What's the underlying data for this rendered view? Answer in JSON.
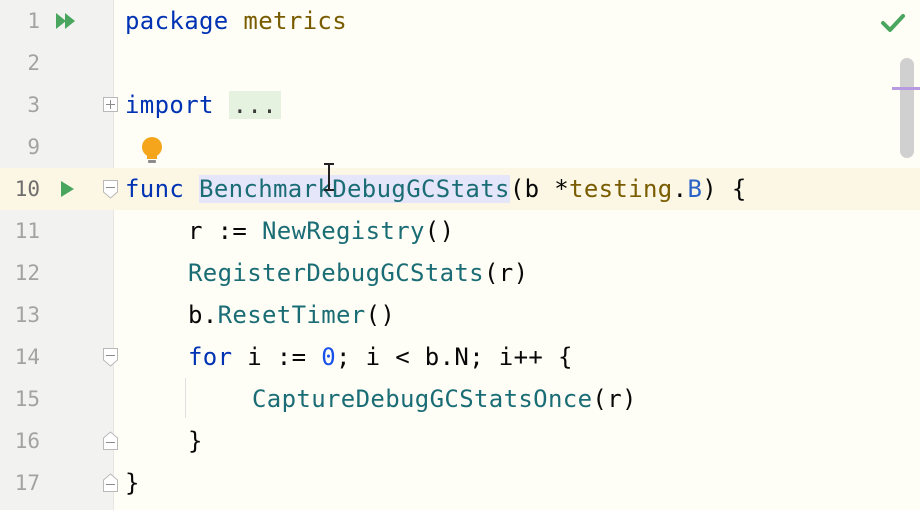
{
  "editor": {
    "status_icon": "check-icon",
    "intention_icon": "lightbulb-icon",
    "lines": [
      {
        "num": "1",
        "parts": [
          {
            "t": "package",
            "c": "kw"
          },
          {
            "t": " "
          },
          {
            "t": "metrics",
            "c": "pkg"
          }
        ]
      },
      {
        "num": "2",
        "parts": []
      },
      {
        "num": "3",
        "parts": [
          {
            "t": "import",
            "c": "kw"
          },
          {
            "t": " "
          },
          {
            "t": "...",
            "c": "fold"
          }
        ]
      },
      {
        "num": "9",
        "parts": []
      },
      {
        "num": "10",
        "parts": [
          {
            "t": "func",
            "c": "kw"
          },
          {
            "t": " "
          },
          {
            "t": "BenchmarkDebugGCStats",
            "c": "fndecl"
          },
          {
            "t": "(b *"
          },
          {
            "t": "testing",
            "c": "type"
          },
          {
            "t": "."
          },
          {
            "t": "B",
            "c": "tsel"
          },
          {
            "t": ") {"
          }
        ]
      },
      {
        "num": "11",
        "parts": [
          {
            "t": "r := "
          },
          {
            "t": "NewRegistry",
            "c": "fn"
          },
          {
            "t": "()"
          }
        ]
      },
      {
        "num": "12",
        "parts": [
          {
            "t": "RegisterDebugGCStats",
            "c": "fn"
          },
          {
            "t": "(r)"
          }
        ]
      },
      {
        "num": "13",
        "parts": [
          {
            "t": "b."
          },
          {
            "t": "ResetTimer",
            "c": "fn"
          },
          {
            "t": "()"
          }
        ]
      },
      {
        "num": "14",
        "parts": [
          {
            "t": "for",
            "c": "kw"
          },
          {
            "t": " i := "
          },
          {
            "t": "0",
            "c": "num"
          },
          {
            "t": "; i < b.N; i++ {"
          }
        ]
      },
      {
        "num": "15",
        "parts": [
          {
            "t": "CaptureDebugGCStatsOnce",
            "c": "fn"
          },
          {
            "t": "(r)"
          }
        ]
      },
      {
        "num": "16",
        "parts": [
          {
            "t": "}"
          }
        ]
      },
      {
        "num": "17",
        "parts": [
          {
            "t": "}"
          }
        ]
      }
    ]
  }
}
